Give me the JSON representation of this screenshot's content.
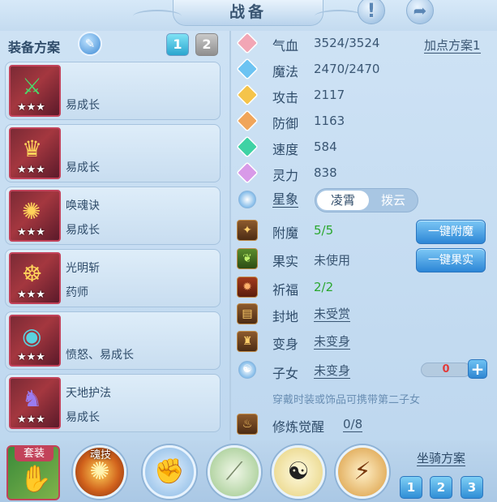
{
  "header": {
    "title": "战备",
    "alert_icon": "!",
    "share_icon": "➦"
  },
  "plans": {
    "label": "装备方案",
    "buttons": [
      "1",
      "2"
    ],
    "selected": "1"
  },
  "equipment": [
    {
      "name": "",
      "effect": "易成长",
      "stars": "★★★"
    },
    {
      "name": "",
      "effect": "易成长",
      "stars": "★★★"
    },
    {
      "name": "唤魂诀",
      "effect": "易成长",
      "stars": "★★★"
    },
    {
      "name": "光明斩",
      "effect": "药师",
      "stars": "★★★"
    },
    {
      "name": "",
      "effect": "愤怒、易成长",
      "stars": "★★★"
    },
    {
      "name": "天地护法",
      "effect": "易成长",
      "stars": "★★★"
    }
  ],
  "stats": {
    "hp": {
      "label": "气血",
      "value": "3524/3524"
    },
    "mp": {
      "label": "魔法",
      "value": "2470/2470"
    },
    "atk": {
      "label": "攻击",
      "value": "2117"
    },
    "def": {
      "label": "防御",
      "value": "1163"
    },
    "spd": {
      "label": "速度",
      "value": "584"
    },
    "spirit": {
      "label": "灵力",
      "value": "838"
    }
  },
  "point_plan": "加点方案1",
  "constellation": {
    "label": "星象",
    "options": [
      "凌霄",
      "拨云"
    ],
    "selected": "凌霄"
  },
  "extras": {
    "enchant": {
      "label": "附魔",
      "value": "5/5",
      "button": "一键附魔"
    },
    "fruit": {
      "label": "果实",
      "value": "未使用",
      "button": "一键果实"
    },
    "blessing": {
      "label": "祈福",
      "value": "2/2"
    },
    "land": {
      "label": "封地",
      "value": "未受赏"
    },
    "transform": {
      "label": "变身",
      "value": "未变身"
    },
    "child": {
      "label": "子女",
      "value": "未变身",
      "count": "0"
    },
    "child_hint": "穿戴时装或饰品可携带第二子女",
    "cultivation": {
      "label": "修炼觉醒",
      "value": "0/8"
    }
  },
  "bottom": {
    "suit_label": "套装",
    "soul_label": "魂技",
    "mount_label": "坐骑方案",
    "mount_buttons": [
      "1",
      "2",
      "3"
    ]
  },
  "colors": {
    "accent": "#2c86d6",
    "value_green": "#2aa72e",
    "counter_red": "#e23b3b"
  }
}
